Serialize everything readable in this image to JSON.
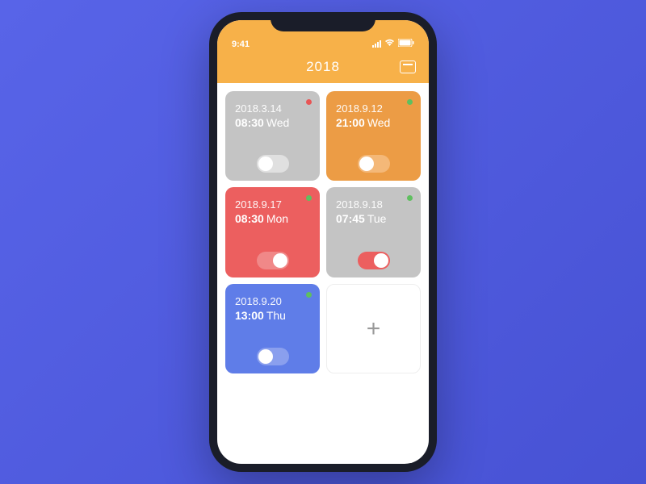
{
  "statusBar": {
    "time": "9:41"
  },
  "header": {
    "title": "2018"
  },
  "cards": [
    {
      "date": "2018.3.14",
      "time": "08:30",
      "day": "Wed",
      "color": "gray",
      "dot": "red",
      "toggle": "off"
    },
    {
      "date": "2018.9.12",
      "time": "21:00",
      "day": "Wed",
      "color": "orange",
      "dot": "green",
      "toggle": "off"
    },
    {
      "date": "2018.9.17",
      "time": "08:30",
      "day": "Mon",
      "color": "red",
      "dot": "green",
      "toggle": "on"
    },
    {
      "date": "2018.9.18",
      "time": "07:45",
      "day": "Tue",
      "color": "gray",
      "dot": "green",
      "toggle": "on"
    },
    {
      "date": "2018.9.20",
      "time": "13:00",
      "day": "Thu",
      "color": "blue",
      "dot": "green",
      "toggle": "off"
    }
  ],
  "addLabel": "+"
}
